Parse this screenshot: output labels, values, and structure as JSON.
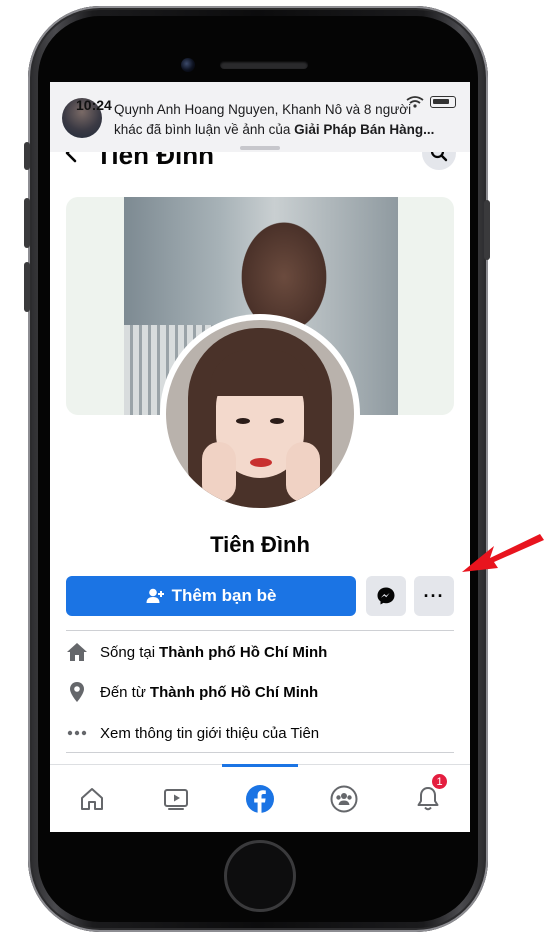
{
  "status_bar": {
    "time": "10:24"
  },
  "notification": {
    "part1": "Quynh Anh Hoang Nguyen, Khanh Nô và 8 người",
    "part2": "khác đã bình luận về ảnh của ",
    "page_name": "Giải Pháp Bán Hàng..."
  },
  "header": {
    "title": "Tiên Đình"
  },
  "profile": {
    "name": "Tiên Đình"
  },
  "actions": {
    "add_friend_label": "Thêm bạn bè",
    "more_label": "···"
  },
  "info": {
    "lives_in_prefix": "Sống tại",
    "lives_in_city": "Thành phố Hồ Chí Minh",
    "from_prefix": "Đến từ",
    "from_city": "Thành phố Hồ Chí Minh",
    "see_about": "Xem thông tin giới thiệu của Tiên"
  },
  "bottom_nav": {
    "items": [
      "home",
      "watch",
      "facebook",
      "groups",
      "notifications"
    ],
    "notification_count": "1"
  },
  "colors": {
    "accent": "#1b74e4",
    "annotation_arrow": "#e8141e",
    "badge": "#e41e3f"
  }
}
